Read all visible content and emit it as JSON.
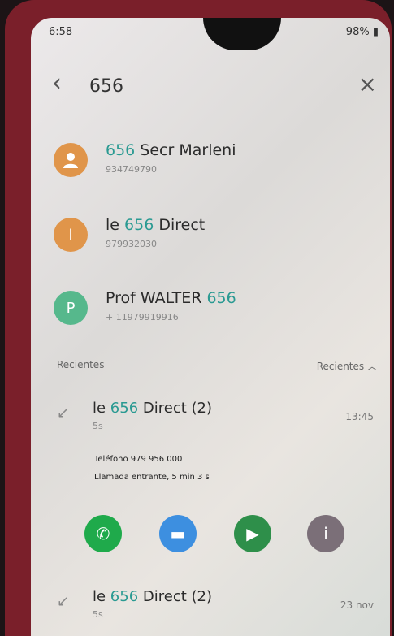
{
  "status_bar": {
    "time": "6:58",
    "right": "98%"
  },
  "search": {
    "query": "656"
  },
  "colors": {
    "avatar_orange": "#e0954a",
    "avatar_green": "#56b88c",
    "call_green": "#1faa4b",
    "message_blue": "#3d8fe0",
    "video_green": "#2e8f4a",
    "info_grey": "#7b6f78",
    "highlight_teal": "#2a9a92"
  },
  "contacts": [
    {
      "initial": "",
      "name_pre": "",
      "name_hl": "656",
      "name_post": " Secr Marleni",
      "number": "934749790"
    },
    {
      "initial": "l",
      "name_pre": "le ",
      "name_hl": "656",
      "name_post": " Direct",
      "number": "979932030"
    },
    {
      "initial": "P",
      "name_pre": "Prof WALTER ",
      "name_hl": "656",
      "name_post": "",
      "number": "+ 11979919916"
    }
  ],
  "recent_section": {
    "label": "Recientes",
    "action": "Recientes"
  },
  "recents": [
    {
      "name_pre": "le ",
      "name_hl": "656",
      "name_post": " Direct (2)",
      "sub": "5s",
      "time": "13:45",
      "detail_phone": "Teléfono 979 956 000",
      "detail_call": "Llamada entrante, 5 min 3 s"
    },
    {
      "name_pre": "le ",
      "name_hl": "656",
      "name_post": " Direct (2)",
      "sub": "5s",
      "time": "23 nov"
    }
  ]
}
